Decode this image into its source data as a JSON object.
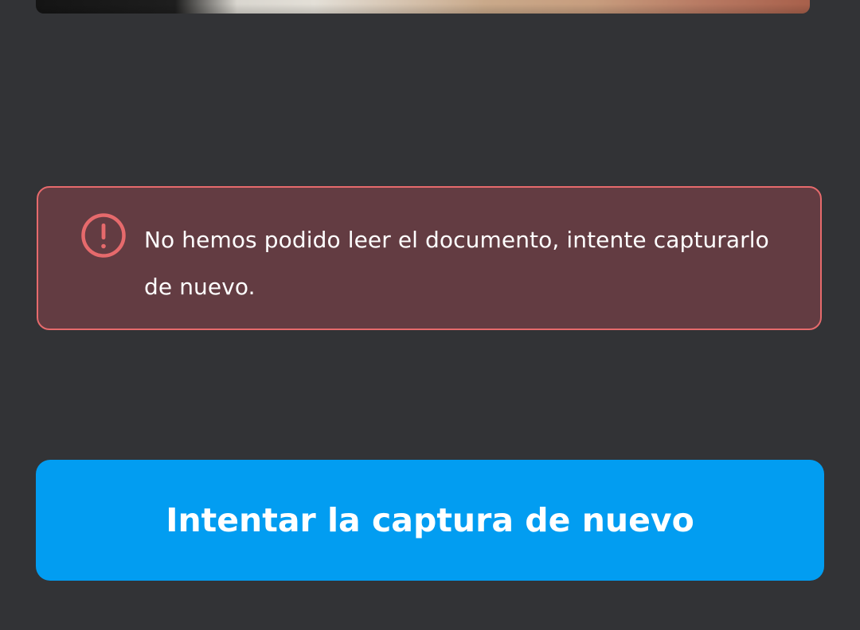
{
  "alert": {
    "icon": "exclamation-circle-icon",
    "message": "No hemos podido leer el documento, intente capturarlo de nuevo.",
    "border_color": "#e66a6c",
    "background_color": "#633c42"
  },
  "actions": {
    "retry_label": "Intentar la captura de nuevo",
    "retry_color": "#029df1"
  },
  "theme": {
    "background": "#323336"
  }
}
